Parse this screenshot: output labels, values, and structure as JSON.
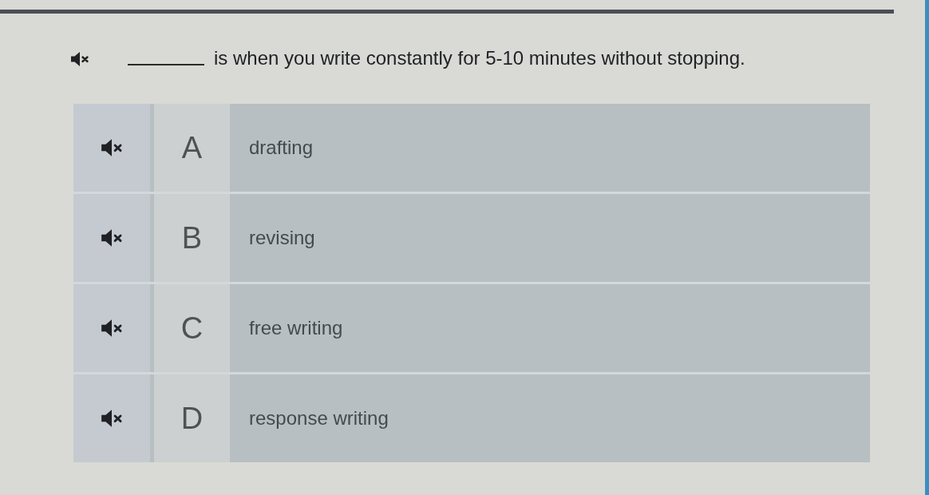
{
  "question": {
    "text": "is when you write constantly for 5-10 minutes without stopping."
  },
  "options": [
    {
      "letter": "A",
      "text": "drafting",
      "selected": false
    },
    {
      "letter": "B",
      "text": "revising",
      "selected": false
    },
    {
      "letter": "C",
      "text": "free writing",
      "selected": false
    },
    {
      "letter": "D",
      "text": "response writing",
      "selected": false
    }
  ]
}
